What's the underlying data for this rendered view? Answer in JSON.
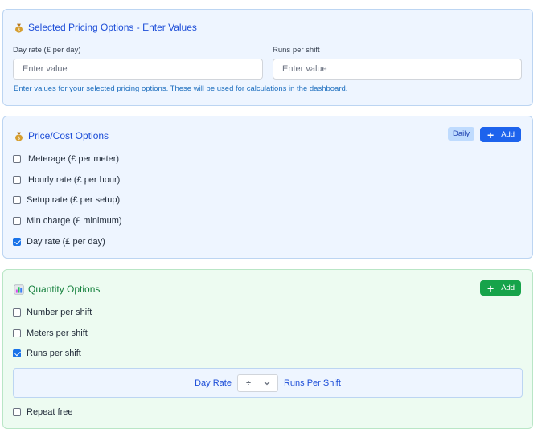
{
  "selected_pricing": {
    "title": "Selected Pricing Options - Enter Values",
    "fields": [
      {
        "label": "Day rate (£ per day)",
        "placeholder": "Enter value",
        "value": ""
      },
      {
        "label": "Runs per shift",
        "placeholder": "Enter value",
        "value": ""
      }
    ],
    "hint": "Enter values for your selected pricing options. These will be used for calculations in the dashboard."
  },
  "price_cost": {
    "title": "Price/Cost Options",
    "badge": "Daily",
    "add_label": "Add",
    "options": [
      {
        "label": "Meterage (£ per meter)",
        "checked": false
      },
      {
        "label": "Hourly rate (£ per hour)",
        "checked": false
      },
      {
        "label": "Setup rate (£ per setup)",
        "checked": false
      },
      {
        "label": "Min charge (£ minimum)",
        "checked": false
      },
      {
        "label": "Day rate (£ per day)",
        "checked": true
      }
    ]
  },
  "quantity": {
    "title": "Quantity Options",
    "add_label": "Add",
    "options": [
      {
        "label": "Number per shift",
        "checked": false
      },
      {
        "label": "Meters per shift",
        "checked": false
      },
      {
        "label": "Runs per shift",
        "checked": true
      }
    ],
    "formula": {
      "left": "Day Rate",
      "operator": "÷",
      "right": "Runs Per Shift"
    },
    "repeat": {
      "label": "Repeat free",
      "checked": false
    }
  },
  "icons": {
    "money_bag": "money-bag-icon",
    "chart": "bar-chart-icon",
    "plus": "plus-icon",
    "chevron": "chevron-down-icon"
  },
  "colors": {
    "accent_blue": "#1d63ed",
    "accent_green": "#16a34a",
    "panel_blue": "#eef5ff",
    "panel_green": "#edfbf1"
  }
}
